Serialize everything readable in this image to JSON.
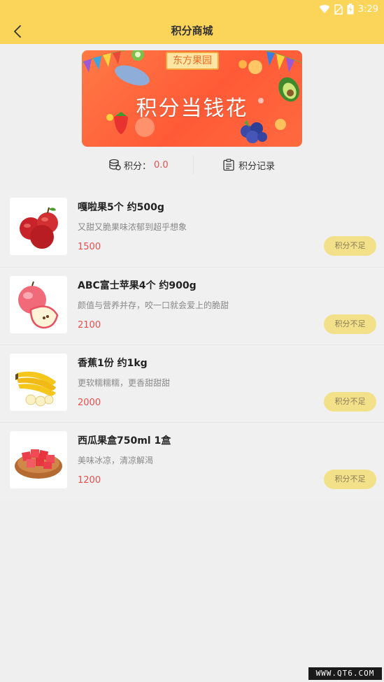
{
  "status_bar": {
    "time": "3:29"
  },
  "header": {
    "title": "积分商城"
  },
  "banner": {
    "brand": "东方果园",
    "slogan": "积分当钱花"
  },
  "points": {
    "label": "积分：",
    "value": "0.0",
    "record_label": "积分记录"
  },
  "products": [
    {
      "name": "嘎啦果5个 约500g",
      "desc": "又甜又脆果味浓郁到超乎想象",
      "price": "1500",
      "button": "积分不足",
      "image": "apples-icon"
    },
    {
      "name": "ABC富士苹果4个 约900g",
      "desc": "颜值与营养并存，咬一口就会爱上的脆甜",
      "price": "2100",
      "button": "积分不足",
      "image": "fuji-apple-icon"
    },
    {
      "name": "香蕉1份 约1kg",
      "desc": "更软糯糯糯，更香甜甜甜",
      "price": "2000",
      "button": "积分不足",
      "image": "banana-icon"
    },
    {
      "name": "西瓜果盒750ml 1盒",
      "desc": "美味冰凉，清凉解渴",
      "price": "1200",
      "button": "积分不足",
      "image": "watermelon-icon"
    }
  ],
  "watermark": "WWW.QT6.COM"
}
